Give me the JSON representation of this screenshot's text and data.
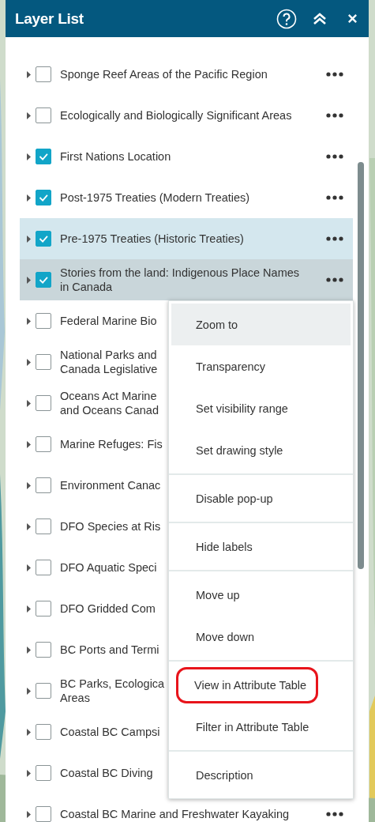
{
  "panel": {
    "title": "Layer List"
  },
  "layers": [
    {
      "lines": [
        "Sponge Reef Areas of the Pacific Region"
      ],
      "checked": false,
      "selected": false,
      "hovered": false,
      "more_button": true
    },
    {
      "lines": [
        "Ecologically and Biologically Significant Areas"
      ],
      "checked": false,
      "selected": false,
      "hovered": false,
      "more_button": true
    },
    {
      "lines": [
        "First Nations Location"
      ],
      "checked": true,
      "selected": false,
      "hovered": false,
      "more_button": true
    },
    {
      "lines": [
        "Post-1975 Treaties (Modern Treaties)"
      ],
      "checked": true,
      "selected": false,
      "hovered": false,
      "more_button": true
    },
    {
      "lines": [
        "Pre-1975 Treaties (Historic Treaties)"
      ],
      "checked": true,
      "selected": true,
      "hovered": false,
      "more_button": true
    },
    {
      "lines": [
        "Stories from the land: Indigenous Place Names",
        "in Canada"
      ],
      "checked": true,
      "selected": false,
      "hovered": true,
      "more_button": true
    },
    {
      "lines": [
        "Federal Marine Bio"
      ],
      "checked": false,
      "selected": false,
      "hovered": false,
      "more_button": false
    },
    {
      "lines": [
        "National Parks and",
        "Canada Legislative"
      ],
      "checked": false,
      "selected": false,
      "hovered": false,
      "more_button": false
    },
    {
      "lines": [
        "Oceans Act Marine",
        "and Oceans Canad"
      ],
      "checked": false,
      "selected": false,
      "hovered": false,
      "more_button": false
    },
    {
      "lines": [
        "Marine Refuges: Fis"
      ],
      "checked": false,
      "selected": false,
      "hovered": false,
      "more_button": false
    },
    {
      "lines": [
        "Environment Canac"
      ],
      "checked": false,
      "selected": false,
      "hovered": false,
      "more_button": false
    },
    {
      "lines": [
        "DFO Species at Ris"
      ],
      "checked": false,
      "selected": false,
      "hovered": false,
      "more_button": false
    },
    {
      "lines": [
        "DFO Aquatic Speci"
      ],
      "checked": false,
      "selected": false,
      "hovered": false,
      "more_button": false
    },
    {
      "lines": [
        "DFO Gridded Com"
      ],
      "checked": false,
      "selected": false,
      "hovered": false,
      "more_button": false
    },
    {
      "lines": [
        "BC Ports and Termi"
      ],
      "checked": false,
      "selected": false,
      "hovered": false,
      "more_button": false
    },
    {
      "lines": [
        "BC Parks, Ecologica",
        "Areas"
      ],
      "checked": false,
      "selected": false,
      "hovered": false,
      "more_button": false
    },
    {
      "lines": [
        "Coastal BC Campsi"
      ],
      "checked": false,
      "selected": false,
      "hovered": false,
      "more_button": false
    },
    {
      "lines": [
        "Coastal BC Diving"
      ],
      "checked": false,
      "selected": false,
      "hovered": false,
      "more_button": false
    },
    {
      "lines": [
        "Coastal BC Marine and Freshwater Kayaking"
      ],
      "checked": false,
      "selected": false,
      "hovered": false,
      "more_button": true
    }
  ],
  "menu": {
    "groups": [
      [
        {
          "label": "Zoom to",
          "hovered": true,
          "framed": false
        },
        {
          "label": "Transparency",
          "hovered": false,
          "framed": false
        },
        {
          "label": "Set visibility range",
          "hovered": false,
          "framed": false
        },
        {
          "label": "Set drawing style",
          "hovered": false,
          "framed": false
        }
      ],
      [
        {
          "label": "Disable pop-up",
          "hovered": false,
          "framed": false
        }
      ],
      [
        {
          "label": "Hide labels",
          "hovered": false,
          "framed": false
        }
      ],
      [
        {
          "label": "Move up",
          "hovered": false,
          "framed": false
        },
        {
          "label": "Move down",
          "hovered": false,
          "framed": false
        }
      ],
      [
        {
          "label": "View in Attribute Table",
          "hovered": false,
          "framed": true
        },
        {
          "label": "Filter in Attribute Table",
          "hovered": false,
          "framed": false
        }
      ],
      [
        {
          "label": "Description",
          "hovered": false,
          "framed": false
        }
      ]
    ]
  }
}
